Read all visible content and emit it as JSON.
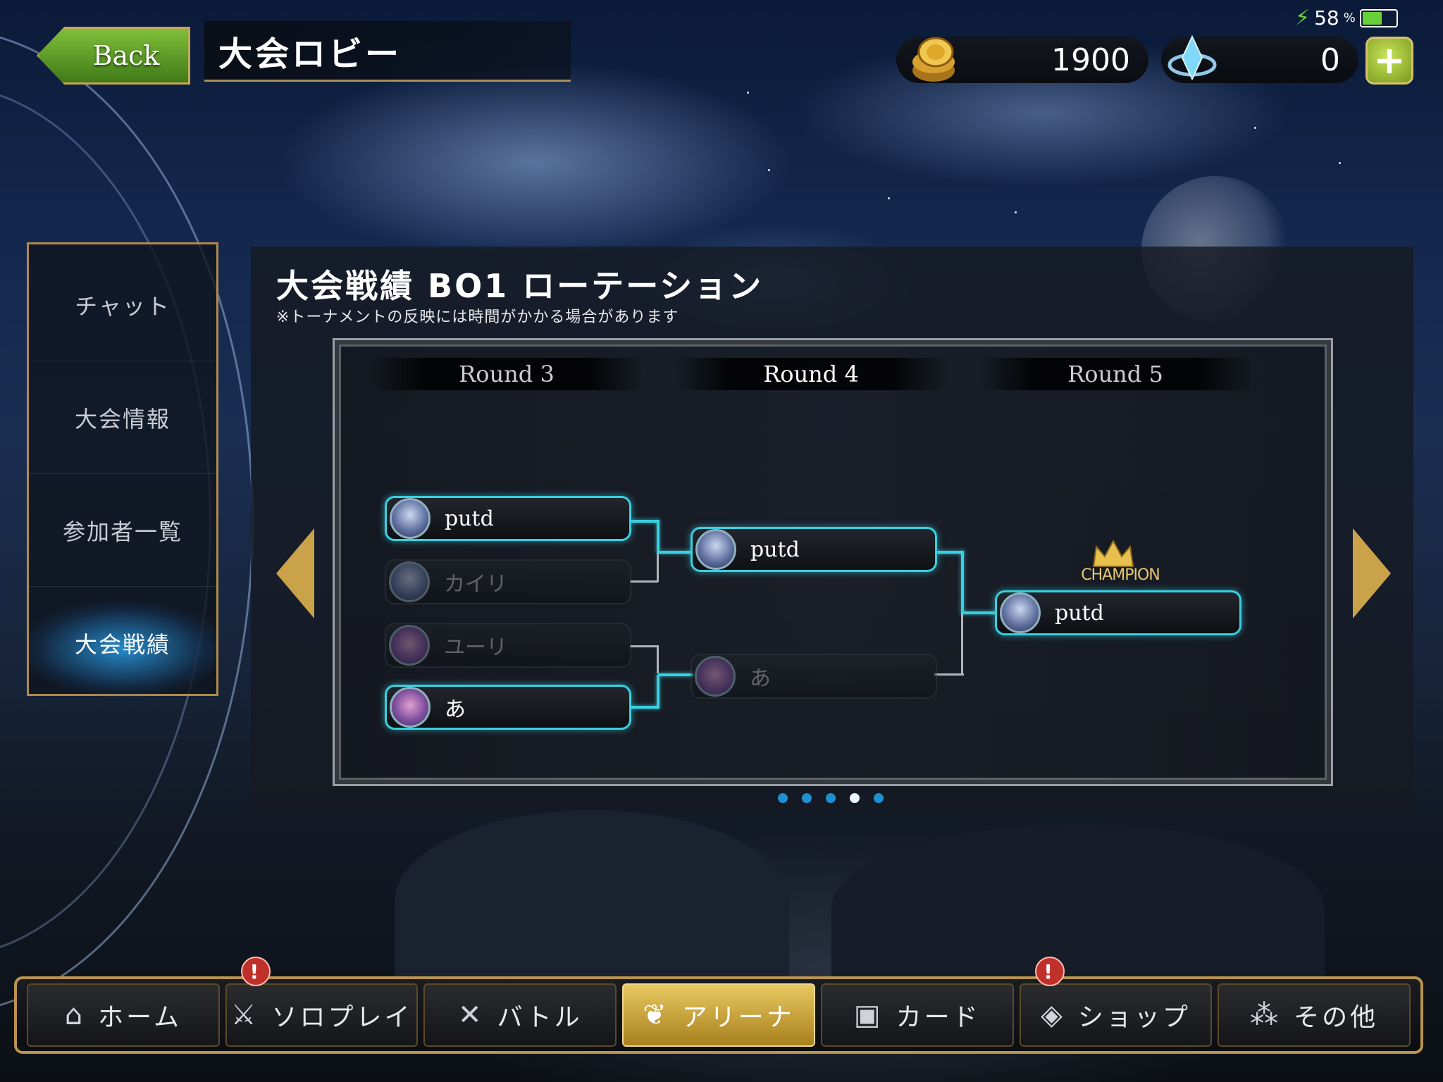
{
  "status": {
    "battery_percent": "58",
    "battery_unit": "%",
    "battery_level": 0.58
  },
  "header": {
    "back_label": "Back",
    "title": "大会ロビー"
  },
  "currency": {
    "gold": "1900",
    "crystals": "0",
    "add_label": "+"
  },
  "side_menu": {
    "items": [
      {
        "label": "チャット"
      },
      {
        "label": "大会情報"
      },
      {
        "label": "参加者一覧"
      },
      {
        "label": "大会戦績"
      }
    ],
    "active_index": 3
  },
  "panel": {
    "title": "大会戦績 BO1 ローテーション",
    "note": "※トーナメントの反映には時間がかかる場合があります"
  },
  "bracket": {
    "rounds": [
      "Round 3",
      "Round 4",
      "Round 5"
    ],
    "round3": [
      {
        "name": "putd",
        "result": "win"
      },
      {
        "name": "カイリ",
        "result": "lose"
      },
      {
        "name": "ユーリ",
        "result": "lose"
      },
      {
        "name": "あ",
        "result": "win"
      }
    ],
    "round4": [
      {
        "name": "putd",
        "result": "win"
      },
      {
        "name": "あ",
        "result": "lose"
      }
    ],
    "round5": [
      {
        "name": "putd",
        "result": "win"
      }
    ],
    "champion_label": "CHAMPION"
  },
  "pager": {
    "total": 5,
    "current": 4
  },
  "nav": {
    "items": [
      {
        "label": "ホーム",
        "icon": "home-icon"
      },
      {
        "label": "ソロプレイ",
        "icon": "solo-icon",
        "badge": "!"
      },
      {
        "label": "バトル",
        "icon": "battle-icon"
      },
      {
        "label": "アリーナ",
        "icon": "arena-icon"
      },
      {
        "label": "カード",
        "icon": "card-icon"
      },
      {
        "label": "ショップ",
        "icon": "shop-icon",
        "badge": "!"
      },
      {
        "label": "その他",
        "icon": "other-icon"
      }
    ],
    "active_index": 3
  },
  "colors": {
    "accent_cyan": "#38d0e0",
    "gold": "#c9a24a",
    "active_nav": "#e8c860"
  }
}
